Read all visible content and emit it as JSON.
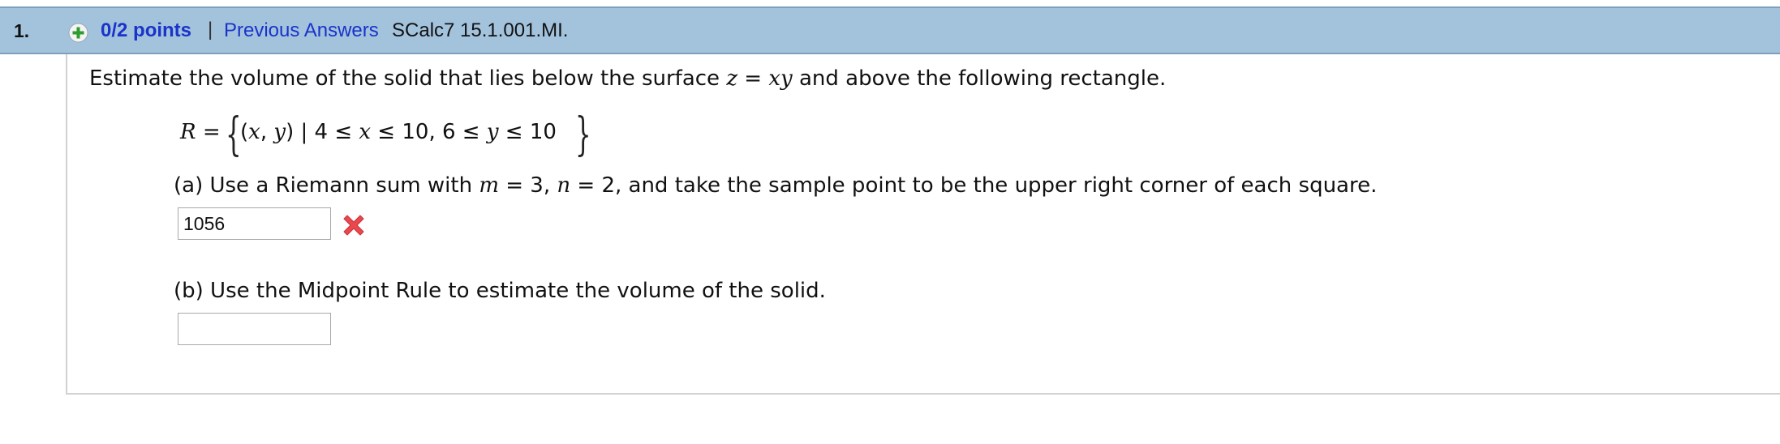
{
  "header": {
    "number": "1.",
    "points": "0/2 points",
    "separator": "|",
    "previous_answers": "Previous Answers",
    "code": "SCalc7 15.1.001.MI."
  },
  "question": {
    "intro_1": "Estimate the volume of the solid that lies below the surface ",
    "z": "z",
    "eq": " = ",
    "xy": "xy",
    "intro_2": " and above the following rectangle."
  },
  "set": {
    "lhs_R": "R",
    "lhs_eq": " =",
    "open": "{",
    "close": "}",
    "paren_open": "(",
    "x": "x",
    "comma": ", ",
    "y": "y",
    "paren_close": ")",
    "bar": " | 4 ≤ ",
    "x2": "x",
    "mid": " ≤ 10, 6 ≤ ",
    "y2": "y",
    "end": " ≤ 10"
  },
  "part_a": {
    "t1": "(a) Use a Riemann sum with ",
    "m": "m",
    "t2": " = 3, ",
    "n": "n",
    "t3": " = 2, and take the sample point to be the upper right corner of each square.",
    "answer": "1056",
    "status": "incorrect"
  },
  "part_b": {
    "text": "(b) Use the Midpoint Rule to estimate the volume of the solid.",
    "answer": ""
  },
  "icons": {
    "plus": "plus-circle-icon",
    "incorrect": "incorrect-x-icon"
  },
  "colors": {
    "header_bg": "#a3c3dd",
    "link": "#1a33c9",
    "plus_green": "#2e9c2e",
    "incorrect_red": "#e8484e"
  }
}
